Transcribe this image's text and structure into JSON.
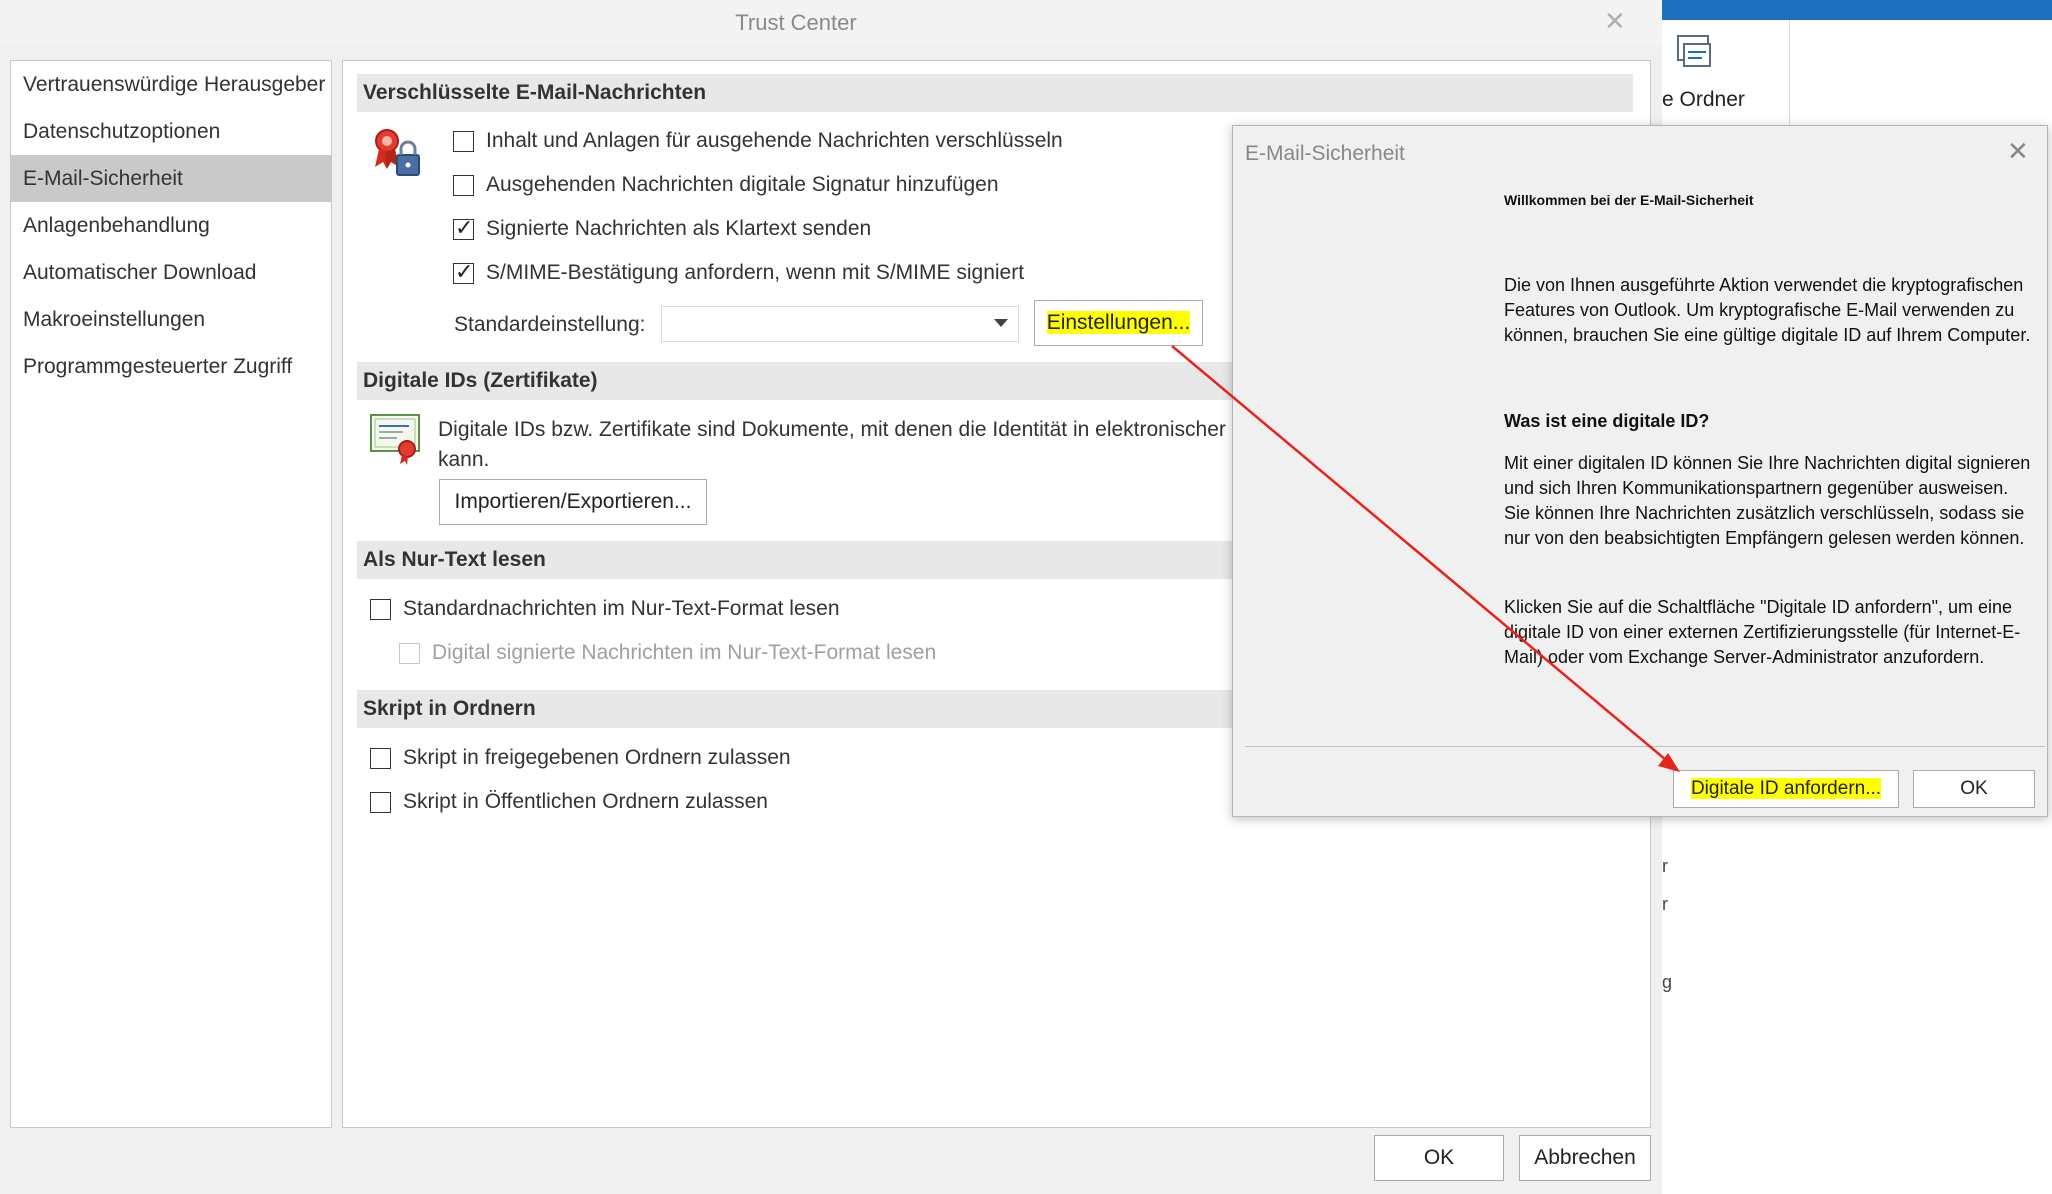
{
  "trust_center": {
    "title": "Trust Center",
    "nav": [
      "Vertrauenswürdige Herausgeber",
      "Datenschutzoptionen",
      "E-Mail-Sicherheit",
      "Anlagenbehandlung",
      "Automatischer Download",
      "Makroeinstellungen",
      "Programmgesteuerter Zugriff"
    ],
    "selected_nav": "E-Mail-Sicherheit",
    "sections": {
      "encrypted": {
        "header": "Verschlüsselte E-Mail-Nachrichten",
        "options": [
          {
            "label": "Inhalt und Anlagen für ausgehende Nachrichten verschlüsseln",
            "checked": false
          },
          {
            "label": "Ausgehenden Nachrichten digitale Signatur hinzufügen",
            "checked": false
          },
          {
            "label": "Signierte Nachrichten als Klartext senden",
            "checked": true
          },
          {
            "label": "S/MIME-Bestätigung anfordern, wenn mit S/MIME signiert",
            "checked": true
          }
        ],
        "default_label": "Standardeinstellung:",
        "default_value": "",
        "settings_button": "Einstellungen..."
      },
      "digital_ids": {
        "header": "Digitale IDs (Zertifikate)",
        "description_line1": "Digitale IDs bzw. Zertifikate sind Dokumente, mit denen die Identität in elektronischer",
        "description_line2": "kann.",
        "import_export_button": "Importieren/Exportieren..."
      },
      "plain_text": {
        "header": "Als Nur-Text lesen",
        "options": [
          {
            "label": "Standardnachrichten im Nur-Text-Format lesen",
            "checked": false,
            "disabled": false
          },
          {
            "label": "Digital signierte Nachrichten im Nur-Text-Format lesen",
            "checked": false,
            "disabled": true
          }
        ]
      },
      "script": {
        "header": "Skript in Ordnern",
        "options": [
          {
            "label": "Skript in freigegebenen Ordnern zulassen",
            "checked": false
          },
          {
            "label": "Skript in Öffentlichen Ordnern zulassen",
            "checked": false
          }
        ]
      }
    },
    "ok_button": "OK",
    "cancel_button": "Abbrechen"
  },
  "background_app": {
    "ribbon_label": "e Ordner",
    "partial_glyphs": [
      "r",
      "r",
      "g"
    ]
  },
  "email_security_dialog": {
    "title": "E-Mail-Sicherheit",
    "welcome": "Willkommen bei der E-Mail-Sicherheit",
    "intro": "Die von Ihnen ausgeführte Aktion verwendet die kryptografischen Features von Outlook. Um kryptografische E-Mail verwenden zu können, brauchen Sie eine gültige digitale ID auf Ihrem Computer.",
    "question": "Was ist eine digitale ID?",
    "explanation": "Mit einer digitalen ID können Sie Ihre Nachrichten digital signieren und sich Ihren Kommunikationspartnern gegenüber ausweisen. Sie können Ihre Nachrichten zusätzlich verschlüsseln, sodass sie nur von den beabsichtigten Empfängern gelesen werden können.",
    "instruction": "Klicken Sie auf die Schaltfläche \"Digitale ID anfordern\", um eine digitale ID von einer externen Zertifizierungsstelle (für Internet-E-Mail) oder vom Exchange Server-Administrator anzufordern.",
    "request_button": "Digitale ID anfordern...",
    "ok_button": "OK"
  },
  "colors": {
    "highlight": "#ffff00",
    "annotation_arrow": "#e8231d",
    "accent_blue": "#1e6fbf"
  }
}
